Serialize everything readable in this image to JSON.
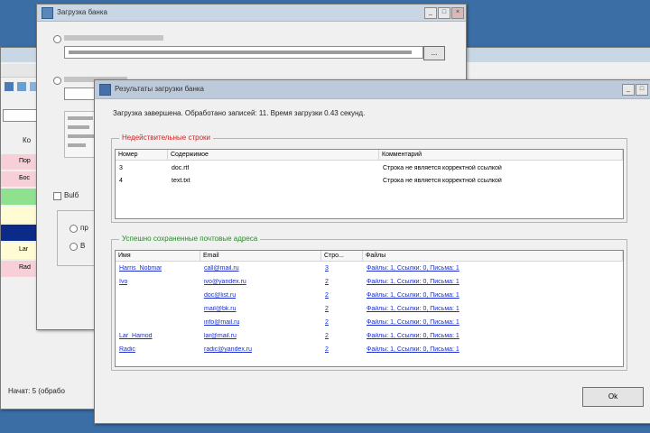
{
  "win_back": {
    "title": "Загрузка банка",
    "browse_label": "...",
    "mode_label": "Bulб",
    "radio_a": "пр",
    "radio_b": "В"
  },
  "win_left": {
    "col_label": "Ко",
    "rows": [
      "Пор",
      "Бос",
      "",
      "",
      "Lar",
      "Rad"
    ],
    "status": "Начат: 5 (обрабо"
  },
  "dialog": {
    "title": "Результаты загрузки банка",
    "summary": "Загрузка завершена. Обработано записей: 11. Время загрузки 0.43 секунд.",
    "errors_group_label": "Недействительные строки",
    "errors_columns": [
      "Номер",
      "Содержимое",
      "Комментарий"
    ],
    "errors_rows": [
      {
        "num": "3",
        "content": "doc.rtf",
        "comment": "Строка не является корректной ссылкой"
      },
      {
        "num": "4",
        "content": "text.txt",
        "comment": "Строка не является корректной ссылкой"
      }
    ],
    "emails_group_label": "Успешно сохраненные почтовые адреса",
    "emails_columns": [
      "Имя",
      "Email",
      "Стро...",
      "Файлы"
    ],
    "emails_rows": [
      {
        "name": "Harris_Nobmar",
        "email": "call@mail.ru",
        "count": "3",
        "files": "Файлы: 1, Ссылки: 0, Письма: 1"
      },
      {
        "name": "Ivo",
        "email": "ivo@yandex.ru",
        "count": "2",
        "files": "Файлы: 1, Ссылки: 0, Письма: 1"
      },
      {
        "name": "",
        "email": "doc@list.ru",
        "count": "2",
        "files": "Файлы: 1, Ссылки: 0, Письма: 1"
      },
      {
        "name": "",
        "email": "mail@bk.ru",
        "count": "2",
        "files": "Файлы: 1, Ссылки: 0, Письма: 1"
      },
      {
        "name": "",
        "email": "info@mail.ru",
        "count": "2",
        "files": "Файлы: 1, Ссылки: 0, Письма: 1"
      },
      {
        "name": "Lar_Hamod",
        "email": "lar@mail.ru",
        "count": "2",
        "files": "Файлы: 1, Ссылки: 0, Письма: 1"
      },
      {
        "name": "Radic",
        "email": "radic@yandex.ru",
        "count": "2",
        "files": "Файлы: 1, Ссылки: 0, Письма: 1"
      }
    ],
    "ok_label": "Ok"
  },
  "colors": {
    "desktop": "#3a6ea5",
    "error_label": "#cc2222",
    "success_label": "#2a8a2a",
    "link": "#1a2ecc"
  }
}
